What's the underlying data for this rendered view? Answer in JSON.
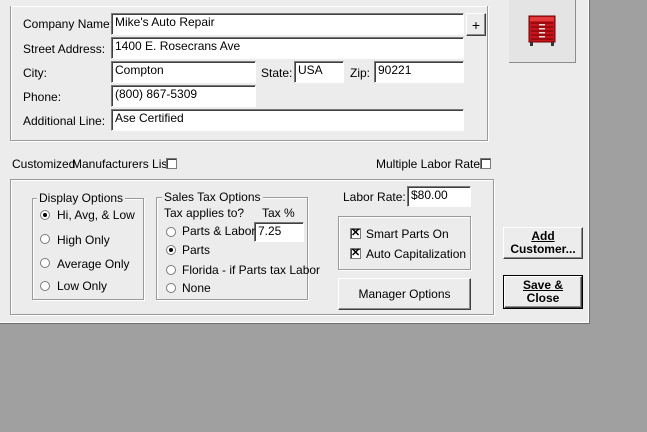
{
  "company": {
    "labels": {
      "company_name": "Company Name:",
      "street_address": "Street Address:",
      "city": "City:",
      "state": "State:",
      "zip": "Zip:",
      "phone": "Phone:",
      "additional_line": "Additional Line:"
    },
    "values": {
      "company_name": "Mike's Auto Repair",
      "street_address": "1400 E. Rosecrans Ave",
      "city": "Compton",
      "state": "USA",
      "zip": "90221",
      "phone": "(800) 867-5309",
      "additional_line": "Ase Certified"
    },
    "plus_button": "+"
  },
  "toolbox_icon": "toolbox-icon",
  "options_row": {
    "customized_label": "Customized",
    "manufacturers_list_label": "Manufacturers List",
    "multiple_labor_rates_label": "Multiple Labor Rates"
  },
  "display_options": {
    "title": "Display Options",
    "items": [
      {
        "label": "Hi, Avg, & Low",
        "selected": true
      },
      {
        "label": "High Only",
        "selected": false
      },
      {
        "label": "Average Only",
        "selected": false
      },
      {
        "label": "Low Only",
        "selected": false
      }
    ]
  },
  "sales_tax": {
    "title": "Sales Tax Options",
    "applies_label": "Tax applies to?",
    "tax_pct_label": "Tax %",
    "tax_value": "7.25",
    "items": [
      {
        "label": "Parts & Labor",
        "selected": false
      },
      {
        "label": "Parts",
        "selected": true
      },
      {
        "label": "Florida - if Parts tax Labor",
        "selected": false
      },
      {
        "label": "None",
        "selected": false
      }
    ]
  },
  "labor": {
    "label": "Labor Rate:",
    "value": "$80.00"
  },
  "smart": {
    "smart_parts_label": "Smart Parts On",
    "smart_parts_checked": true,
    "auto_cap_label": "Auto Capitalization",
    "auto_cap_checked": true
  },
  "buttons": {
    "manager_options": "Manager Options",
    "add_customer_line1": "Add",
    "add_customer_line2": "Customer...",
    "save_close_line1": "Save &",
    "save_close_line2": "Close"
  }
}
